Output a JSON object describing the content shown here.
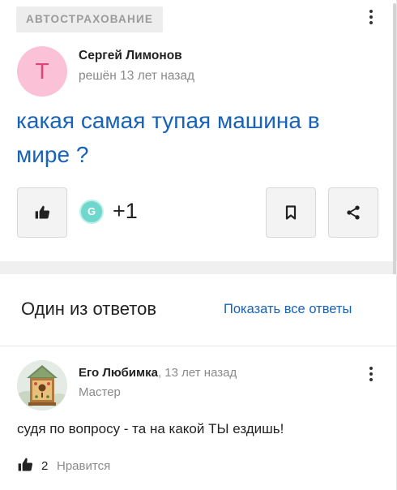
{
  "question": {
    "category": "АВТОСТРАХОВАНИЕ",
    "author": {
      "initial": "Т",
      "name": "Сергей Лимонов",
      "meta": "решён 13 лет назад"
    },
    "title": "какая самая тупая машина в мире ?",
    "reactions": {
      "badge_letter": "G",
      "count": "+1"
    }
  },
  "answers": {
    "heading": "Один из ответов",
    "show_all": "Показать все ответы",
    "items": [
      {
        "author": "Его Любимка",
        "time": ", 13 лет назад",
        "rank": "Мастер",
        "text": "судя по вопросу - та на какой ТЫ ездишь!",
        "likes": "2",
        "like_label": "Нравится"
      }
    ]
  },
  "icons": {
    "like": "thumbs-up-icon",
    "bookmark": "bookmark-icon",
    "share": "share-icon",
    "more": "more-vertical-icon"
  },
  "colors": {
    "link": "#1862b8",
    "avatar_bg": "#fac1d7",
    "avatar_fg": "#e0427b",
    "badge": "#6fd7cb"
  }
}
